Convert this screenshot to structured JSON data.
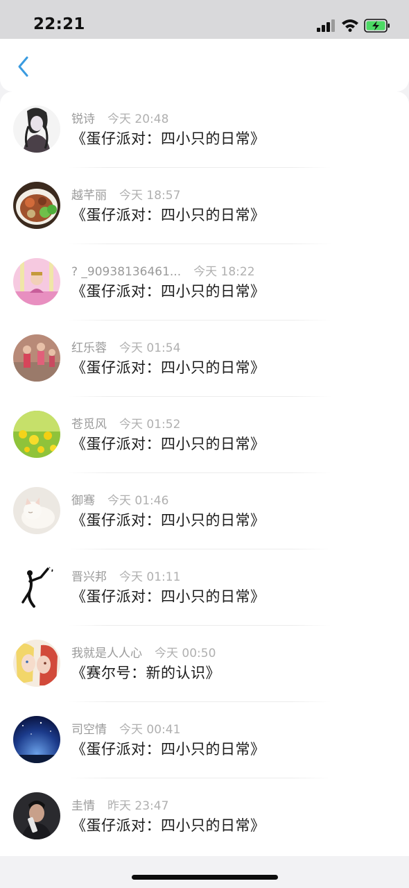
{
  "status_bar": {
    "time": "22:21"
  },
  "nav": {
    "back_icon": "chevron-left-icon",
    "accent_color": "#3a9be0"
  },
  "items": [
    {
      "name": "锐诗",
      "time": "今天 20:48",
      "title": "《蛋仔派对：四小只的日常》",
      "avatar": "anime-girl-sketch"
    },
    {
      "name": "越芊丽",
      "time": "今天 18:57",
      "title": "《蛋仔派对：四小只的日常》",
      "avatar": "food-bowl"
    },
    {
      "name": "? _90938136461...",
      "time": "今天 18:22",
      "title": "《蛋仔派对：四小只的日常》",
      "avatar": "pink-doll"
    },
    {
      "name": "红乐蓉",
      "time": "今天 01:54",
      "title": "《蛋仔派对：四小只的日常》",
      "avatar": "dancers"
    },
    {
      "name": "苍觅风",
      "time": "今天 01:52",
      "title": "《蛋仔派对：四小只的日常》",
      "avatar": "dandelions"
    },
    {
      "name": "御骞",
      "time": "今天 01:46",
      "title": "《蛋仔派对：四小只的日常》",
      "avatar": "white-cat"
    },
    {
      "name": "晋兴邦",
      "time": "今天 01:11",
      "title": "《蛋仔派对：四小只的日常》",
      "avatar": "stick-figure"
    },
    {
      "name": "我就是人人心",
      "time": "今天 00:50",
      "title": "《赛尔号：新的认识》",
      "avatar": "anime-couple"
    },
    {
      "name": "司空情",
      "time": "今天 00:41",
      "title": "《蛋仔派对：四小只的日常》",
      "avatar": "night-sky"
    },
    {
      "name": "圭情",
      "time": "昨天 23:47",
      "title": "《蛋仔派对：四小只的日常》",
      "avatar": "man-photo"
    }
  ]
}
